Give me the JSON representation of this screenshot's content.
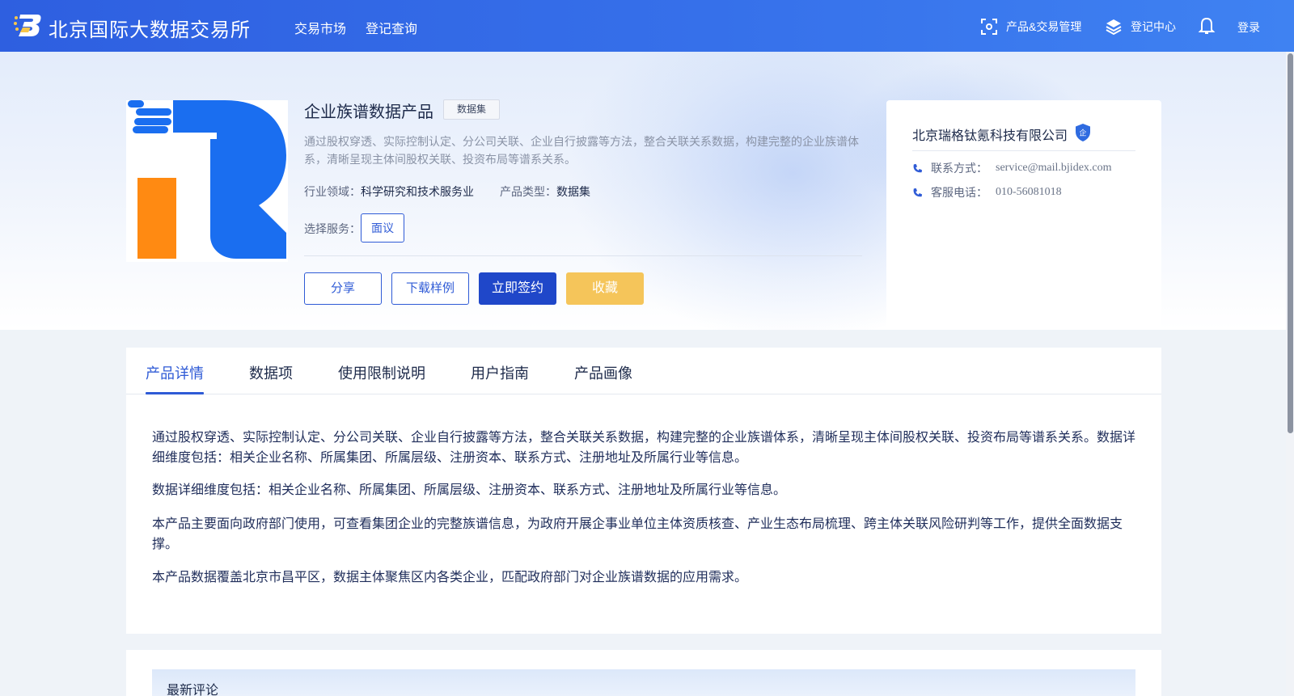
{
  "header": {
    "site_title": "北京国际大数据交易所",
    "nav": [
      "交易市场",
      "登记查询"
    ],
    "product_trade_mgmt": "产品&交易管理",
    "register_center": "登记中心",
    "login": "登录",
    "icons": [
      "logo-icon",
      "scan-icon",
      "layers-icon",
      "bell-icon"
    ]
  },
  "product": {
    "title": "企业族谱数据产品",
    "badge": "数据集",
    "description": "通过股权穿透、实际控制认定、分公司关联、企业自行披露等方法，整合关联关系数据，构建完整的企业族谱体系，清晰呈现主体间股权关联、投资布局等谱系关系。",
    "industry_label": "行业领域：",
    "industry_value": "科学研究和技术服务业",
    "type_label": "产品类型：",
    "type_value": "数据集",
    "service_label": "选择服务：",
    "service_option": "面议",
    "buttons": {
      "share": "分享",
      "download_sample": "下载样例",
      "sign_now": "立即签约",
      "favorite": "收藏"
    }
  },
  "company": {
    "name": "北京瑞格钛氪科技有限公司",
    "shield_text": "企",
    "contact_label": "联系方式：",
    "contact_value": "service@mail.bjidex.com",
    "phone_label": "客服电话：",
    "phone_value": "010-56081018"
  },
  "tabs": [
    {
      "label": "产品详情",
      "active": true
    },
    {
      "label": "数据项"
    },
    {
      "label": "使用限制说明"
    },
    {
      "label": "用户指南"
    },
    {
      "label": "产品画像"
    }
  ],
  "details": [
    "通过股权穿透、实际控制认定、分公司关联、企业自行披露等方法，整合关联关系数据，构建完整的企业族谱体系，清晰呈现主体间股权关联、投资布局等谱系关系。数据详细维度包括：相关企业名称、所属集团、所属层级、注册资本、联系方式、注册地址及所属行业等信息。",
    "数据详细维度包括：相关企业名称、所属集团、所属层级、注册资本、联系方式、注册地址及所属行业等信息。",
    "本产品主要面向政府部门使用，可查看集团企业的完整族谱信息，为政府开展企事业单位主体资质核查、产业生态布局梳理、跨主体关联风险研判等工作，提供全面数据支撑。",
    "本产品数据覆盖北京市昌平区，数据主体聚焦区内各类企业，匹配政府部门对企业族谱数据的应用需求。"
  ],
  "comments": {
    "title": "最新评论"
  },
  "colors": {
    "header_start": "#2e5fe0",
    "header_end": "#3f82f2",
    "primary": "#1f47c9",
    "accent": "#2f5bd6",
    "favorite": "#f5c55a",
    "logo_blue": "#1a6ef0",
    "logo_orange": "#ff8a12"
  }
}
